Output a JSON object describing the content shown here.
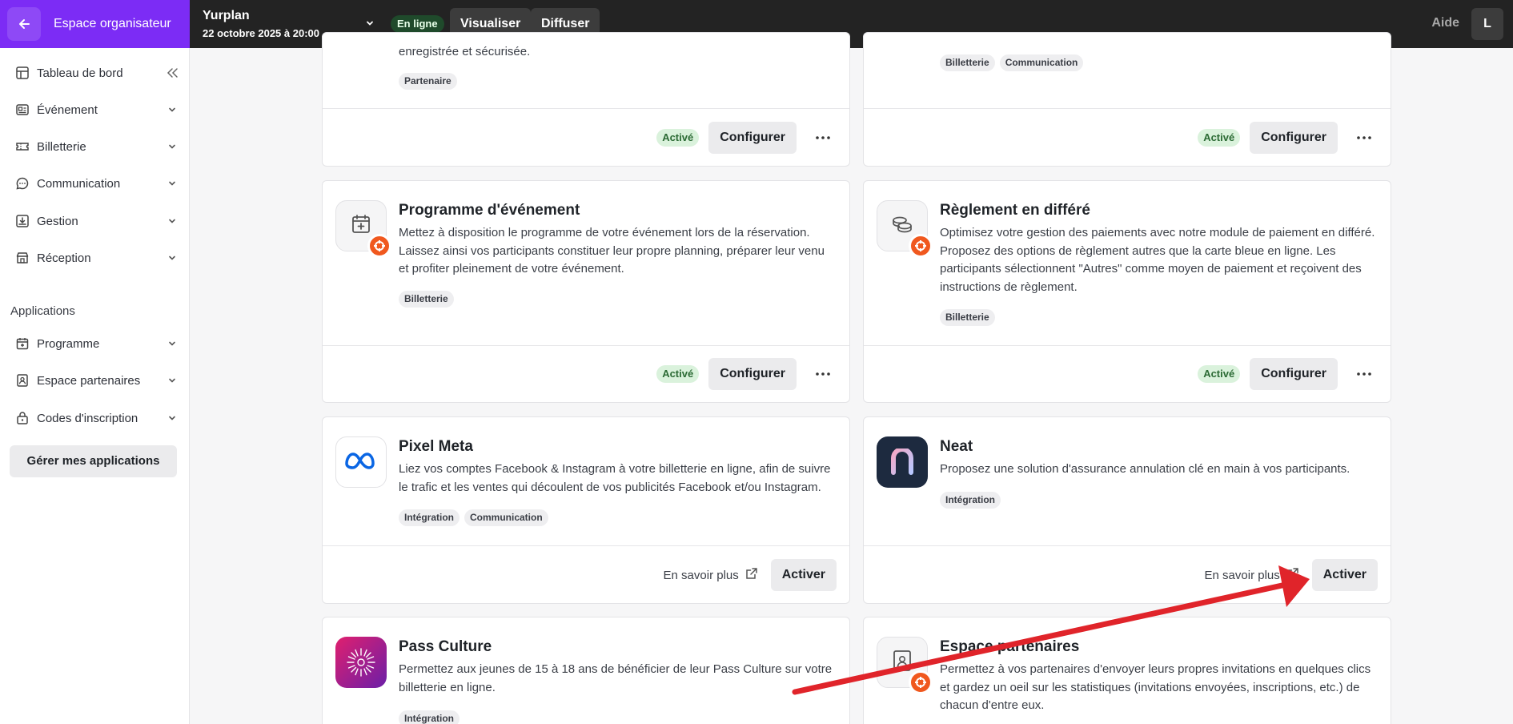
{
  "topbar": {
    "brand_label": "Espace organisateur",
    "event_name": "Yurplan",
    "event_date": "22 octobre 2025 à 20:00",
    "status_badge": "En ligne",
    "preview_label": "Visualiser",
    "share_label": "Diffuser",
    "help_label": "Aide",
    "avatar_initial": "L"
  },
  "sidebar": {
    "items": [
      {
        "label": "Tableau de bord",
        "icon": "dashboard-icon"
      },
      {
        "label": "Événement",
        "icon": "event-card-icon"
      },
      {
        "label": "Billetterie",
        "icon": "ticket-icon"
      },
      {
        "label": "Communication",
        "icon": "chat-bubble-icon"
      },
      {
        "label": "Gestion",
        "icon": "download-box-icon"
      },
      {
        "label": "Réception",
        "icon": "store-icon"
      }
    ],
    "apps_section_title": "Applications",
    "app_items": [
      {
        "label": "Programme",
        "icon": "calendar-icon"
      },
      {
        "label": "Espace partenaires",
        "icon": "partner-badge-icon"
      },
      {
        "label": "Codes d'inscription",
        "icon": "lock-code-icon"
      }
    ],
    "manage_apps_label": "Gérer mes applications"
  },
  "cards": [
    {
      "description_tail": "enregistrée et sécurisée.",
      "tags": [
        "Partenaire"
      ],
      "status": "Activé",
      "configure_label": "Configurer"
    },
    {
      "tags": [
        "Billetterie",
        "Communication"
      ],
      "status": "Activé",
      "configure_label": "Configurer"
    },
    {
      "title": "Programme d'événement",
      "description": "Mettez à disposition le programme de votre événement lors de la réservation. Laissez ainsi vos participants constituer leur propre planning, préparer leur venu et profiter pleinement de votre événement.",
      "tags": [
        "Billetterie"
      ],
      "status": "Activé",
      "configure_label": "Configurer"
    },
    {
      "title": "Règlement en différé",
      "description": "Optimisez votre gestion des paiements avec notre module de paiement en différé. Proposez des options de règlement autres que la carte bleue en ligne. Les participants sélectionnent \"Autres\" comme moyen de paiement et reçoivent des instructions de règlement.",
      "tags": [
        "Billetterie"
      ],
      "status": "Activé",
      "configure_label": "Configurer"
    },
    {
      "title": "Pixel Meta",
      "description": "Liez vos comptes Facebook & Instagram à votre billetterie en ligne, afin de suivre le trafic et les ventes qui découlent de vos publicités Facebook et/ou Instagram.",
      "tags": [
        "Intégration",
        "Communication"
      ],
      "learn_more_label": "En savoir plus",
      "activate_label": "Activer"
    },
    {
      "title": "Neat",
      "description": "Proposez une solution d'assurance annulation clé en main à vos participants.",
      "tags": [
        "Intégration"
      ],
      "learn_more_label": "En savoir plus",
      "activate_label": "Activer"
    },
    {
      "title": "Pass Culture",
      "description": "Permettez aux jeunes de 15 à 18 ans de bénéficier de leur Pass Culture sur votre billetterie en ligne.",
      "tags": [
        "Intégration"
      ]
    },
    {
      "title": "Espace partenaires",
      "description": "Permettez à vos partenaires d'envoyer leurs propres invitations en quelques clics et gardez un oeil sur les statistiques (invitations envoyées, inscriptions, etc.) de chacun d'entre eux."
    }
  ],
  "colors": {
    "brand_purple": "#7c2cf5",
    "badge_orange": "#f0581e",
    "arrow_red": "#e0242a",
    "active_green_bg": "#daf2dc"
  }
}
